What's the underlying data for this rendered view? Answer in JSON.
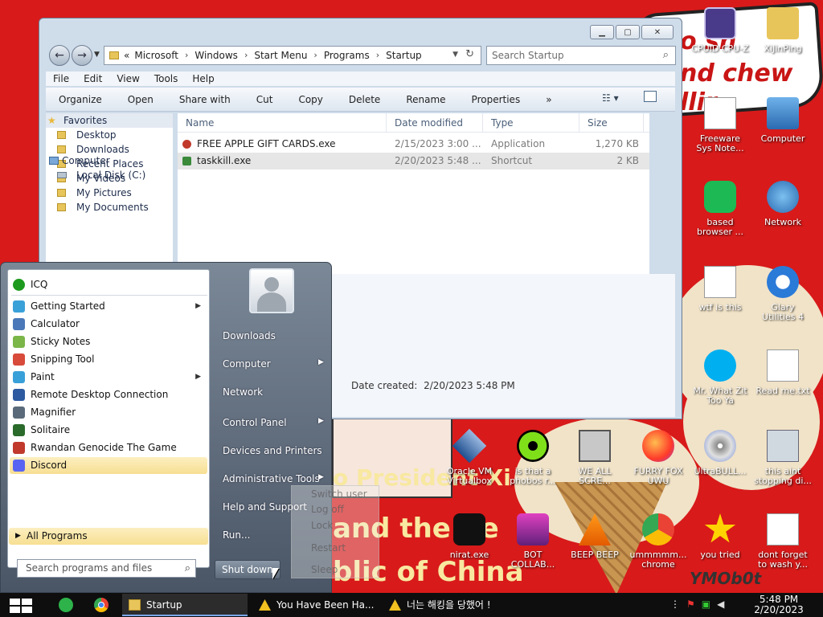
{
  "wallpaper": {
    "text1": "o sh",
    "text2": "nd chew",
    "text3": "llir",
    "text4": "o President Xi",
    "text5": "and the Pe",
    "text6": "blic of China",
    "signature": "YMOb0t"
  },
  "desktop_icons": [
    {
      "label": "CPUID CPU-Z",
      "icon": "cpuz-icon"
    },
    {
      "label": "XiJinPing",
      "icon": "folder-person-icon"
    },
    {
      "label": "Freeware Sys Note...",
      "icon": "document-icon"
    },
    {
      "label": "Computer",
      "icon": "computer-icon"
    },
    {
      "label": "based browser ...",
      "icon": "green-chat-icon"
    },
    {
      "label": "Network",
      "icon": "network-icon"
    },
    {
      "label": "wtf is this",
      "icon": "calendar-doc-icon"
    },
    {
      "label": "Glary Utilities 4",
      "icon": "glary-icon"
    },
    {
      "label": "Mr. What Zit Too Ya",
      "icon": "skype-icon"
    },
    {
      "label": "Read me.txt",
      "icon": "text-file-icon"
    },
    {
      "label": "Oracle VM Virtualbox",
      "icon": "virtualbox-icon"
    },
    {
      "label": "is that a phobos r...",
      "icon": "icq-icon"
    },
    {
      "label": "WE ALL SCRE...",
      "icon": "computer-old-icon"
    },
    {
      "label": "FURRY FOX UWU",
      "icon": "firefox-icon"
    },
    {
      "label": "UltraBULL...",
      "icon": "disc-icon"
    },
    {
      "label": "this aint stopping di...",
      "icon": "installer-icon"
    },
    {
      "label": "nirat.exe",
      "icon": "skull-icon"
    },
    {
      "label": "BOT COLLAB...",
      "icon": "tv-icon"
    },
    {
      "label": "BEEP BEEP",
      "icon": "vlc-icon"
    },
    {
      "label": "ummmmm... chrome",
      "icon": "chrome-icon"
    },
    {
      "label": "you tried",
      "icon": "star-icon"
    },
    {
      "label": "dont forget to wash y...",
      "icon": "calendar-doc-icon"
    }
  ],
  "explorer": {
    "address": {
      "prefix": "«",
      "crumbs": [
        "Microsoft",
        "Windows",
        "Start Menu",
        "Programs",
        "Startup"
      ]
    },
    "search_placeholder": "Search Startup",
    "menu": [
      "File",
      "Edit",
      "View",
      "Tools",
      "Help"
    ],
    "toolbar": [
      "Organize",
      "Open",
      "Share with",
      "Cut",
      "Copy",
      "Delete",
      "Rename",
      "Properties",
      "»"
    ],
    "nav": {
      "favorites": "Favorites",
      "fav_items": [
        "Desktop",
        "Downloads",
        "Recent Places",
        "My Videos",
        "My Pictures",
        "My Documents"
      ],
      "computer": "Computer",
      "drives": [
        "Local Disk (C:)"
      ]
    },
    "columns": [
      "Name",
      "Date modified",
      "Type",
      "Size"
    ],
    "files": [
      {
        "name": "FREE APPLE GIFT CARDS.exe",
        "date": "2/15/2023 3:00 ...",
        "type": "Application",
        "size": "1,270 KB"
      },
      {
        "name": "taskkill.exe",
        "date": "2/20/2023 5:48 ...",
        "type": "Shortcut",
        "size": "2 KB"
      }
    ],
    "details": {
      "date_created_label": "Date created:",
      "date_created_value": "2/20/2023 5:48 PM"
    }
  },
  "start_menu": {
    "pinned": [
      {
        "label": "ICQ",
        "icon": "icq-icon",
        "color": "#1d9a1d"
      }
    ],
    "recent": [
      {
        "label": "Getting Started",
        "icon": "getting-started-icon",
        "color": "#3aa0d8",
        "submenu": true
      },
      {
        "label": "Calculator",
        "icon": "calculator-icon",
        "color": "#4a78b8",
        "submenu": false
      },
      {
        "label": "Sticky Notes",
        "icon": "sticky-notes-icon",
        "color": "#7ab648",
        "submenu": false
      },
      {
        "label": "Snipping Tool",
        "icon": "snipping-tool-icon",
        "color": "#d84a3a",
        "submenu": false
      },
      {
        "label": "Paint",
        "icon": "paint-icon",
        "color": "#38a0d8",
        "submenu": true
      },
      {
        "label": "Remote Desktop Connection",
        "icon": "remote-desktop-icon",
        "color": "#2d5aa0",
        "submenu": false
      },
      {
        "label": "Magnifier",
        "icon": "magnifier-icon",
        "color": "#5a6a7a",
        "submenu": false
      },
      {
        "label": "Solitaire",
        "icon": "solitaire-icon",
        "color": "#2a6a2a",
        "submenu": false
      },
      {
        "label": "Rwandan Genocide The Game",
        "icon": "game-icon",
        "color": "#c0392b",
        "submenu": false
      },
      {
        "label": "Discord",
        "icon": "discord-icon",
        "color": "#5865f2",
        "submenu": false
      }
    ],
    "all_programs": "All Programs",
    "search_placeholder": "Search programs and files",
    "right": [
      {
        "label": "Downloads",
        "submenu": false
      },
      {
        "label": "Computer",
        "submenu": true
      },
      {
        "label": "Network",
        "submenu": false
      },
      {
        "label": "Control Panel",
        "submenu": true
      },
      {
        "label": "Devices and Printers",
        "submenu": false
      },
      {
        "label": "Administrative Tools",
        "submenu": true
      },
      {
        "label": "Help and Support",
        "submenu": false
      },
      {
        "label": "Run...",
        "submenu": false
      }
    ],
    "shutdown": "Shut down",
    "shutdown_submenu": [
      "Switch user",
      "Log off",
      "Lock",
      "Restart",
      "Sleep"
    ]
  },
  "taskbar": {
    "tasks": [
      {
        "label": "Startup",
        "icon": "folder-icon"
      },
      {
        "label": "You Have Been Ha...",
        "icon": "warning-icon"
      },
      {
        "label": "너는 해킹을 당했어 !",
        "icon": "warning-icon"
      }
    ],
    "clock_time": "5:48 PM",
    "clock_date": "2/20/2023"
  }
}
